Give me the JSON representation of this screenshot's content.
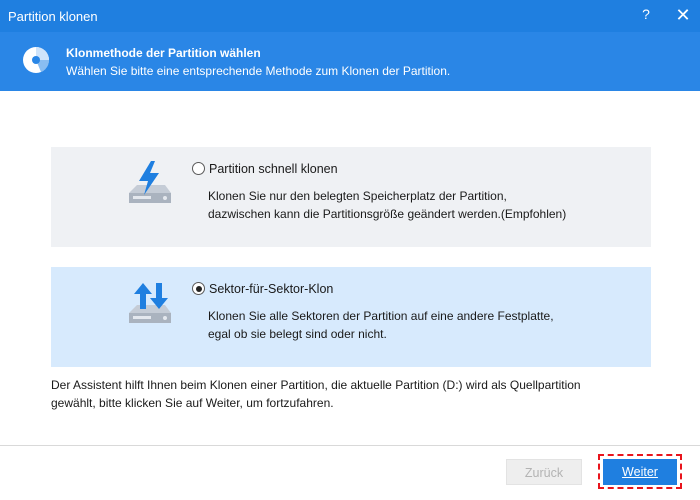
{
  "window": {
    "title": "Partition klonen",
    "help_glyph": "?",
    "close_glyph": "✕"
  },
  "header": {
    "title": "Klonmethode der Partition wählen",
    "subtitle": "Wählen Sie bitte eine entsprechende Methode zum Klonen der Partition."
  },
  "options": [
    {
      "label": "Partition schnell klonen",
      "description_line1": "Klonen Sie nur den belegten Speicherplatz der Partition,",
      "description_line2": "dazwischen kann die Partitionsgröße geändert werden.(Empfohlen)",
      "selected": false,
      "icon": "disk-lightning-icon"
    },
    {
      "label": "Sektor-für-Sektor-Klon",
      "description_line1": "Klonen Sie alle Sektoren der Partition auf eine andere Festplatte,",
      "description_line2": "egal ob sie belegt sind oder nicht.",
      "selected": true,
      "icon": "disk-arrows-icon"
    }
  ],
  "info": {
    "line1": "Der Assistent hilft Ihnen beim Klonen einer Partition, die aktuelle Partition (D:) wird als Quellpartition",
    "line2": "gewählt, bitte klicken Sie auf Weiter, um fortzufahren."
  },
  "buttons": {
    "back_label": "Zurück",
    "next_label": "Weiter"
  },
  "colors": {
    "titlebar": "#1f7fe0",
    "header": "#2a86e6",
    "selected_option": "#d7eafd",
    "unselected_option": "#eff1f4",
    "highlight_outline": "#e8141c"
  }
}
